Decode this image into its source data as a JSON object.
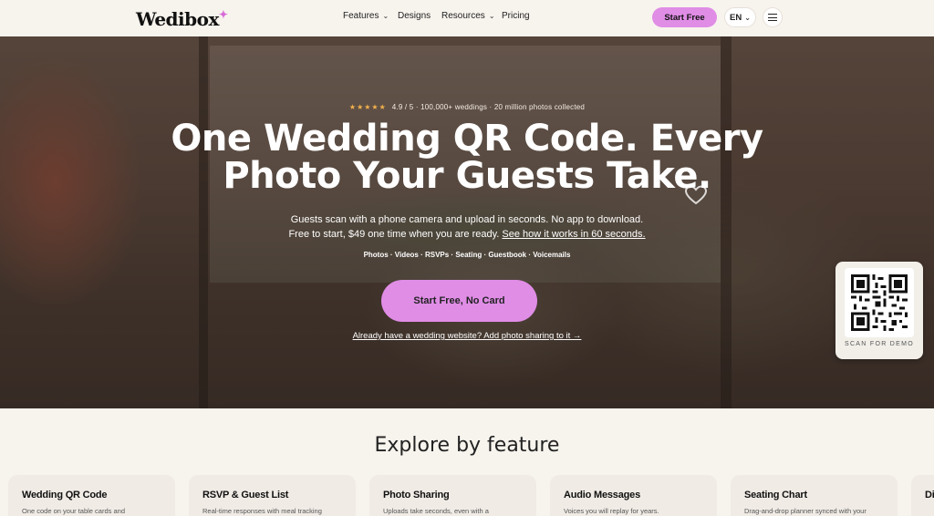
{
  "header": {
    "logo": "Wedibox",
    "nav": [
      {
        "label": "Features",
        "dropdown": true
      },
      {
        "label": "Designs",
        "dropdown": false
      },
      {
        "label": "Resources",
        "dropdown": true
      },
      {
        "label": "Pricing",
        "dropdown": false
      }
    ],
    "start_free": "Start Free",
    "language": "EN"
  },
  "hero": {
    "stars": "★★★★★",
    "rating_text": "4.9 / 5 · 100,000+ weddings · 20 million photos collected",
    "headline_line1": "One Wedding QR Code. Every",
    "headline_line2": "Photo Your Guests Take.",
    "sub_line1": "Guests scan with a phone camera and upload in seconds. No app to download.",
    "sub_line2": "Free to start, $49 one time when you are ready.",
    "sub_link": "See how it works in 60 seconds.",
    "pills": "Photos · Videos · RSVPs · Seating · Guestbook · Voicemails",
    "cta": "Start Free, No Card",
    "already": "Already have a wedding website? Add photo sharing to it →",
    "qr_label": "SCAN FOR DEMO"
  },
  "explore": {
    "title": "Explore by feature",
    "cards": [
      {
        "title": "Wedding QR Code",
        "desc": "One code on your table cards and"
      },
      {
        "title": "RSVP & Guest List",
        "desc": "Real-time responses with meal tracking"
      },
      {
        "title": "Photo Sharing",
        "desc": "Uploads take seconds, even with a"
      },
      {
        "title": "Audio Messages",
        "desc": "Voices you will replay for years."
      },
      {
        "title": "Seating Chart",
        "desc": "Drag-and-drop planner synced with your"
      },
      {
        "title": "Dig",
        "desc": ""
      }
    ]
  },
  "colors": {
    "accent": "#e08de6",
    "background": "#f7f3ed",
    "star": "#f2b14c"
  }
}
